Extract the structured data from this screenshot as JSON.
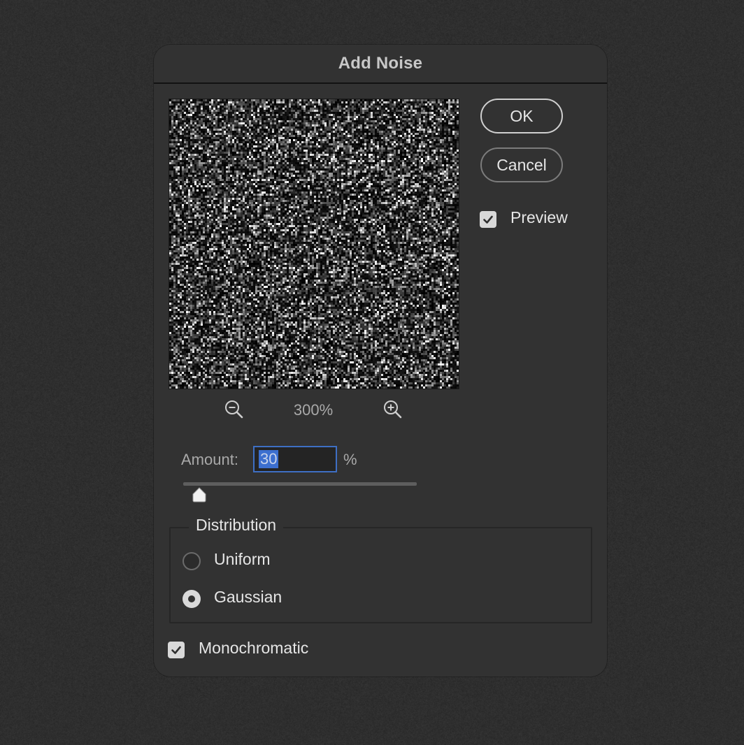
{
  "dialog": {
    "title": "Add Noise",
    "zoom": {
      "value": "300%",
      "zoom_out_icon": "zoom-out-magnifier-icon",
      "zoom_in_icon": "zoom-in-magnifier-icon"
    },
    "buttons": {
      "ok": "OK",
      "cancel": "Cancel"
    },
    "preview": {
      "label": "Preview",
      "checked": true
    },
    "amount": {
      "label": "Amount:",
      "value": "30",
      "unit": "%",
      "slider_fraction": 0.07
    },
    "distribution": {
      "title": "Distribution",
      "options": [
        {
          "label": "Uniform",
          "selected": false
        },
        {
          "label": "Gaussian",
          "selected": true
        }
      ]
    },
    "monochromatic": {
      "label": "Monochromatic",
      "checked": true
    }
  },
  "colors": {
    "dialog_bg": "#323232",
    "backdrop": "#2e2e2e",
    "input_focus": "#3e6fc4",
    "text_selection": "#3c6fcf"
  }
}
